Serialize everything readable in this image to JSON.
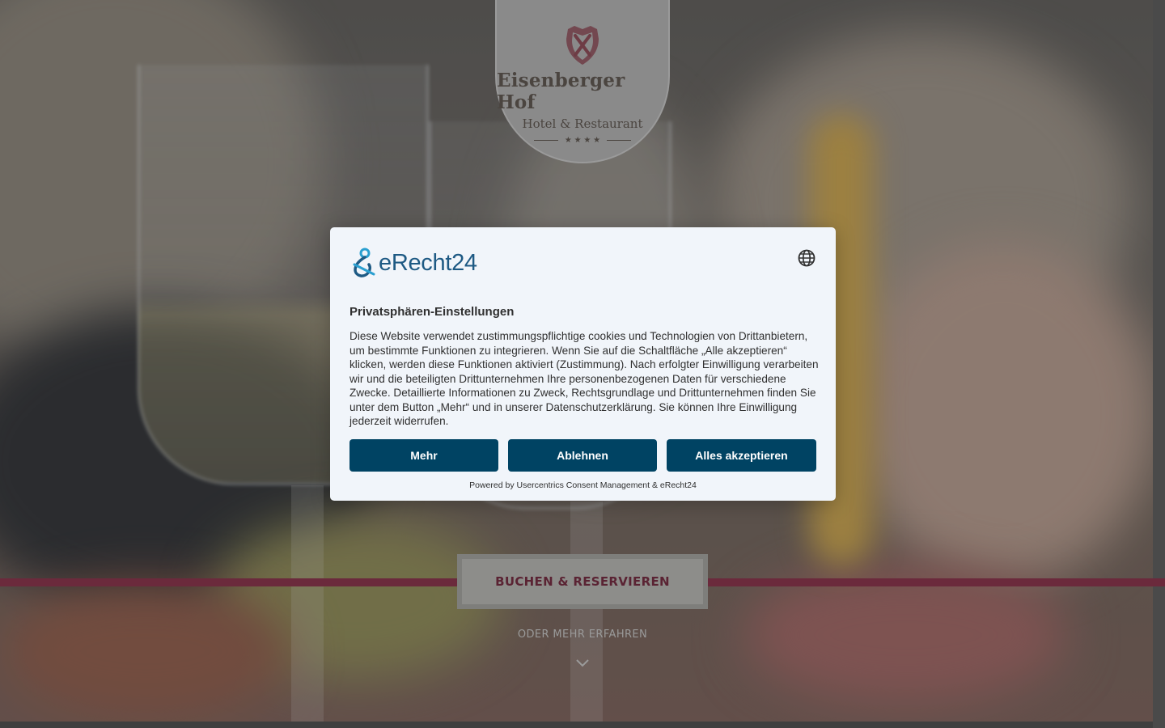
{
  "logo": {
    "name": "Eisenberger Hof",
    "subtitle": "Hotel & Restaurant",
    "stars": "★ ★ ★ ★"
  },
  "hero": {
    "book_button": "BUCHEN & RESERVIEREN",
    "more_link": "ODER MEHR ERFAHREN"
  },
  "consent": {
    "brand": "eRecht24",
    "title": "Privatsphären-Einstellungen",
    "text": "Diese Website verwendet zustimmungspflichtige cookies und Technologien von Drittanbietern, um bestimmte Funktionen zu integrieren. Wenn Sie auf die Schaltfläche „Alle akzeptieren“ klicken, werden diese Funktionen aktiviert (Zustimmung). Nach erfolgter Einwilligung verarbeiten wir und die beteiligten Drittunternehmen Ihre personenbezogenen Daten für verschiedene Zwecke. Detaillierte Informationen zu Zweck, Rechtsgrundlage und Drittunternehmen finden Sie unter dem Button „Mehr“ und in unserer Datenschutzerklärung. Sie können Ihre Einwilligung jederzeit widerrufen.",
    "buttons": {
      "more": "Mehr",
      "decline": "Ablehnen",
      "accept_all": "Alles akzeptieren"
    },
    "powered_by": "Powered by Usercentrics Consent Management & eRecht24"
  },
  "colors": {
    "accent_band": "#6b2a3c",
    "consent_button": "#004363",
    "brand_blue": "#1e5a84"
  },
  "icons": [
    "crest-icon",
    "globe-icon",
    "chevron-down-icon",
    "erecht24-logo-icon"
  ]
}
